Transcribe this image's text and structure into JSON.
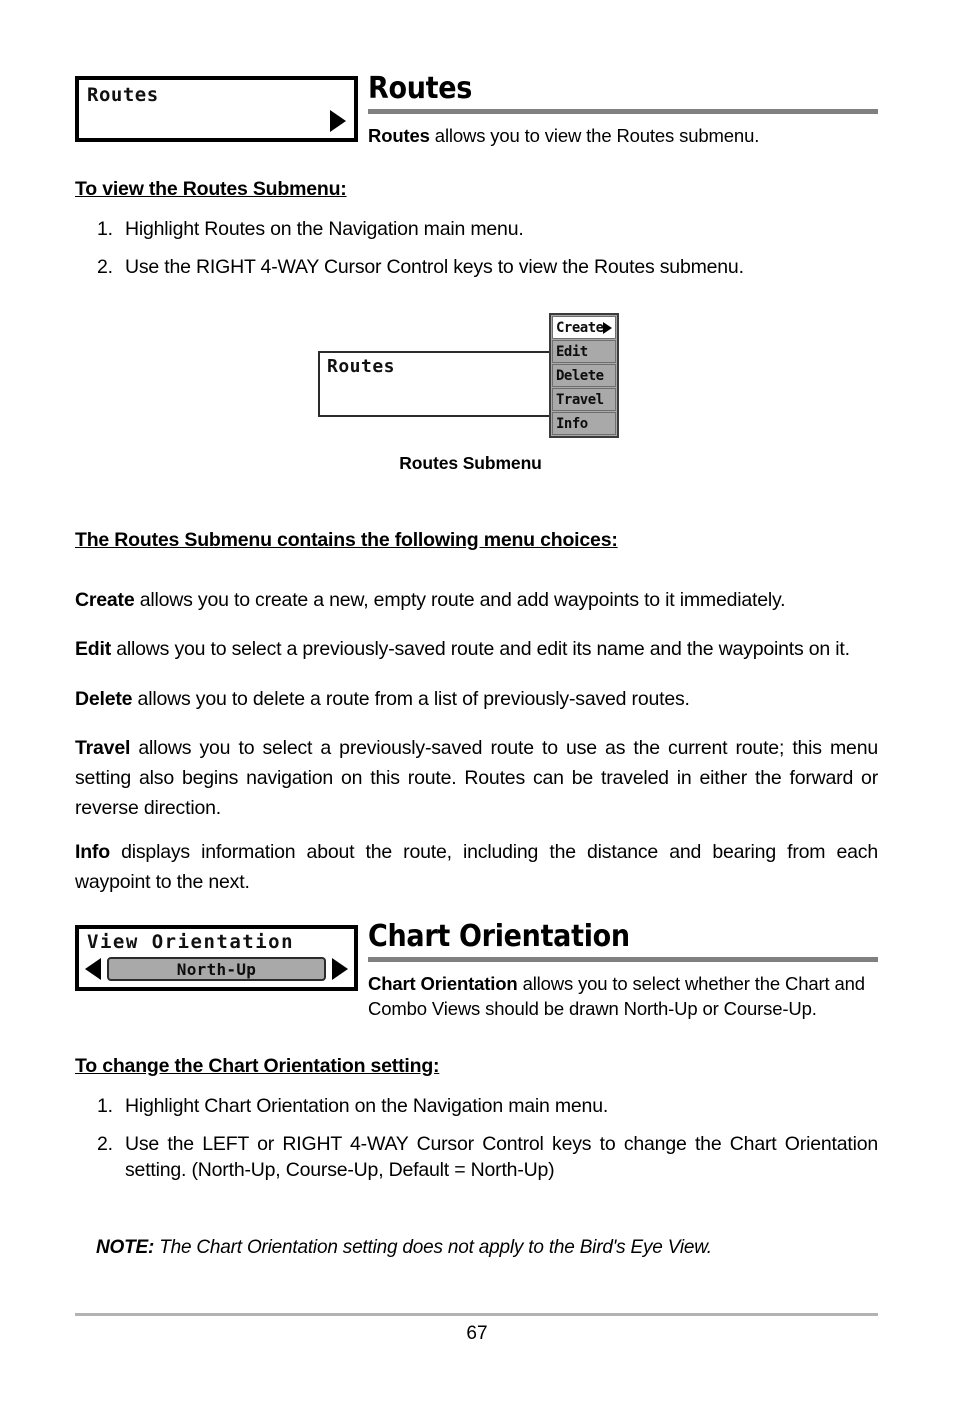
{
  "page": {
    "number": "67"
  },
  "routes_section": {
    "widget": {
      "label": "Routes",
      "arrow_icon": "triangle-right-icon"
    },
    "heading": "Routes",
    "intro_bold": "Routes",
    "intro_rest": " allows you to view the Routes submenu.",
    "procedure_heading": "To view the Routes Submenu:",
    "steps": [
      {
        "num": "1.",
        "text": "Highlight Routes on the Navigation main menu."
      },
      {
        "num": "2.",
        "text": "Use the RIGHT 4-WAY Cursor Control keys to view the Routes submenu."
      }
    ],
    "figure": {
      "box_label": "Routes",
      "caption": "Routes Submenu",
      "submenu_items": [
        {
          "label": "Create",
          "selected": true,
          "has_arrow": true
        },
        {
          "label": "Edit",
          "selected": false,
          "has_arrow": false
        },
        {
          "label": "Delete",
          "selected": false,
          "has_arrow": false
        },
        {
          "label": "Travel",
          "selected": false,
          "has_arrow": false
        },
        {
          "label": "Info",
          "selected": false,
          "has_arrow": false
        }
      ]
    },
    "choices_heading": "The Routes Submenu contains the following menu choices:",
    "choices": [
      {
        "term": "Create",
        "desc": " allows you to create a new, empty route and add waypoints to it immediately."
      },
      {
        "term": "Edit",
        "desc": " allows you to select a previously-saved route and edit its name and the waypoints on it."
      },
      {
        "term": "Delete",
        "desc": " allows you to delete a route from a list of previously-saved routes."
      },
      {
        "term": "Travel",
        "desc": " allows you to select a previously-saved route to use as the current route; this menu setting also begins navigation on this route. Routes can be traveled in either the forward or reverse direction."
      },
      {
        "term": "Info",
        "desc": " displays information about the route, including the distance and bearing from each waypoint to the next."
      }
    ]
  },
  "chart_orientation_section": {
    "widget": {
      "title": "View Orientation",
      "value": "North-Up",
      "left_arrow_icon": "triangle-left-icon",
      "right_arrow_icon": "triangle-right-icon"
    },
    "heading": "Chart Orientation",
    "intro_bold": "Chart Orientation",
    "intro_rest": " allows you to select whether the Chart and Combo Views should be drawn North-Up or Course-Up.",
    "procedure_heading": "To change the Chart Orientation setting:",
    "steps": [
      {
        "num": "1.",
        "text": "Highlight Chart Orientation on the Navigation main menu."
      },
      {
        "num": "2.",
        "text": "Use the LEFT or RIGHT 4-WAY Cursor Control keys to change the Chart Orientation setting. (North-Up, Course-Up, Default = North-Up)"
      }
    ],
    "note_label": "NOTE:",
    "note_text": " The Chart Orientation setting does not apply to the Bird's Eye View."
  },
  "colors": {
    "rule_gray": "#808080",
    "footer_rule_gray": "#b3b3b3",
    "lcd_gray": "#a9a9a9",
    "ink": "#000000"
  }
}
